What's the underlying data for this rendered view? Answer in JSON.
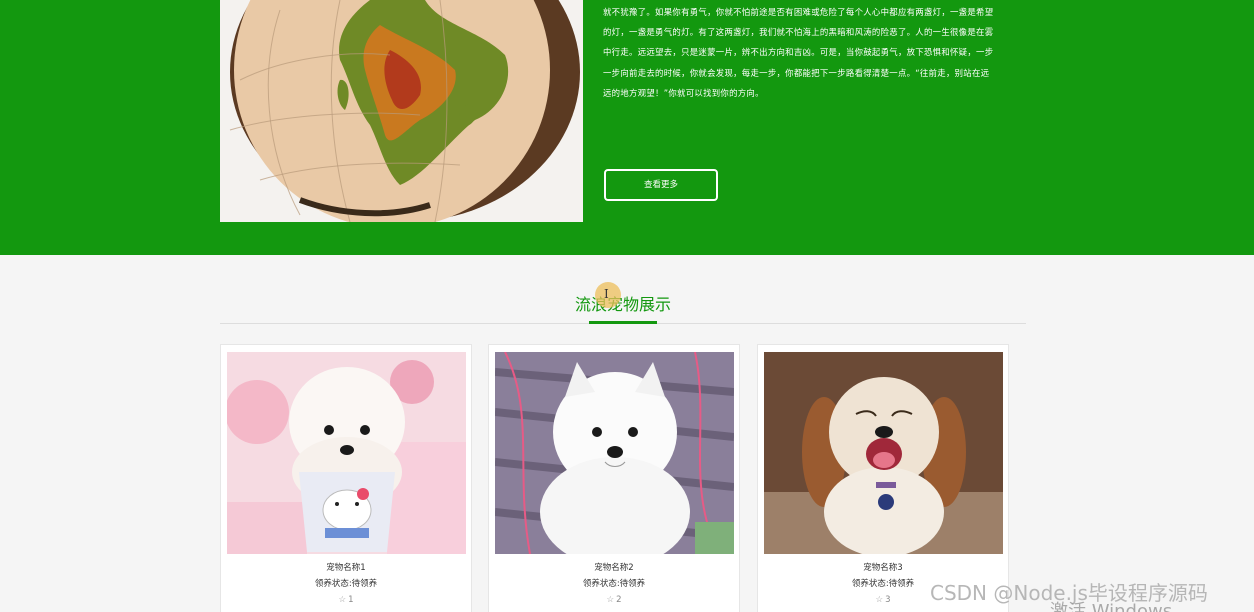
{
  "hero": {
    "text_lines": [
      "就不犹豫了。如果你有勇气，你就不怕前途是否有困难或危险了每个人心中都应有两盏灯，一盏是希望",
      "的灯，一盏是勇气的灯。有了这两盏灯，我们就不怕海上的黑暗和风涛的险恶了。人的一生很像是在雾",
      "中行走。远远望去，只是迷蒙一片，辨不出方向和吉凶。可是，当你鼓起勇气，放下恐惧和怀疑，一步",
      "一步向前走去的时候，你就会发现，每走一步，你都能把下一步路看得清楚一点。“往前走，别站在远",
      "远的地方观望！”你就可以找到你的方向。"
    ],
    "more_button_label": "查看更多"
  },
  "section": {
    "title": "流浪宠物展示"
  },
  "pets": [
    {
      "name": "宠物名称1",
      "status": "领养状态:待领养",
      "likes": "1"
    },
    {
      "name": "宠物名称2",
      "status": "领养状态:待领养",
      "likes": "2"
    },
    {
      "name": "宠物名称3",
      "status": "领养状态:待领养",
      "likes": "3"
    }
  ],
  "icons": {
    "likes": "star-outline-icon"
  },
  "colors": {
    "primary_green": "#13980f",
    "page_bg": "#f5f5f5"
  },
  "overlay": {
    "watermark": "CSDN @Node.js毕设程序源码",
    "activation": "激活 Windows"
  }
}
